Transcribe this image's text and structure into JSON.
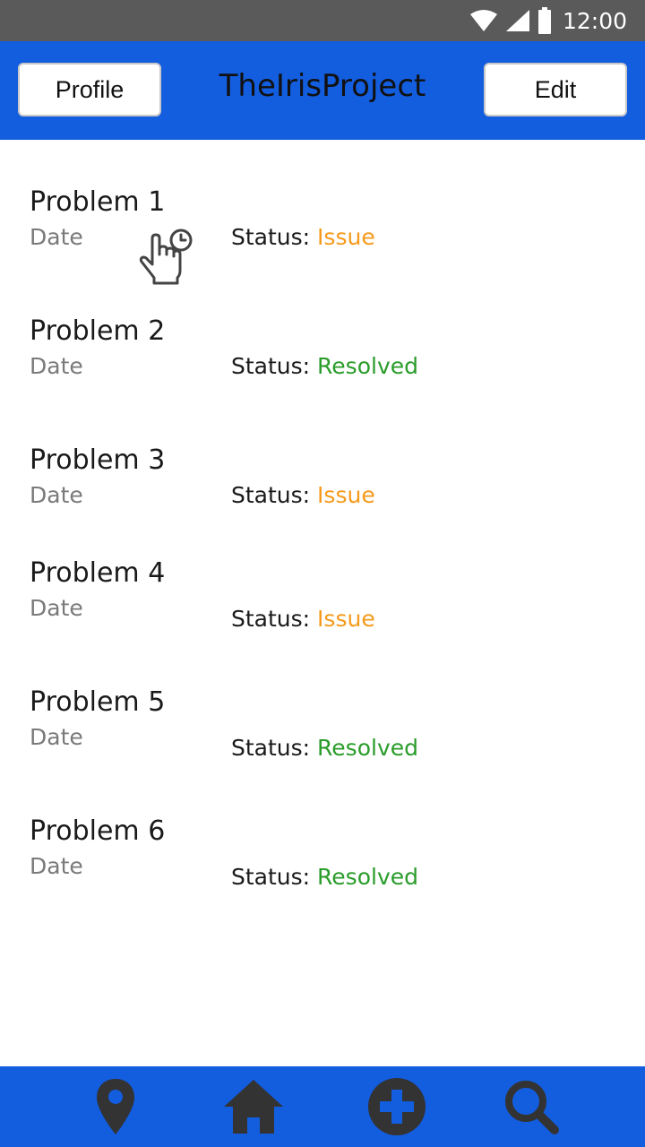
{
  "status_bar": {
    "time": "12:00",
    "icons": [
      "wifi-icon",
      "signal-icon",
      "battery-icon"
    ]
  },
  "header": {
    "title": "TheIrisProject",
    "profile_label": "Profile",
    "edit_label": "Edit"
  },
  "problems": [
    {
      "title": "Problem 1",
      "date": "Date",
      "status_label": "Status:",
      "status": "Issue"
    },
    {
      "title": "Problem 2",
      "date": "Date",
      "status_label": "Status:",
      "status": "Resolved"
    },
    {
      "title": "Problem 3",
      "date": "Date",
      "status_label": "Status:",
      "status": "Issue"
    },
    {
      "title": "Problem 4",
      "date": "Date",
      "status_label": "Status:",
      "status": "Issue"
    },
    {
      "title": "Problem 5",
      "date": "Date",
      "status_label": "Status:",
      "status": "Resolved"
    },
    {
      "title": "Problem 6",
      "date": "Date",
      "status_label": "Status:",
      "status": "Resolved"
    }
  ],
  "bottom_nav": {
    "items": [
      "location-icon",
      "home-icon",
      "add-icon",
      "search-icon"
    ]
  },
  "colors": {
    "app_bar": "#135ddf",
    "status_bar": "#5a5a5a",
    "issue": "#f59a1b",
    "resolved": "#2a9c2a",
    "nav_icon": "#333333"
  }
}
